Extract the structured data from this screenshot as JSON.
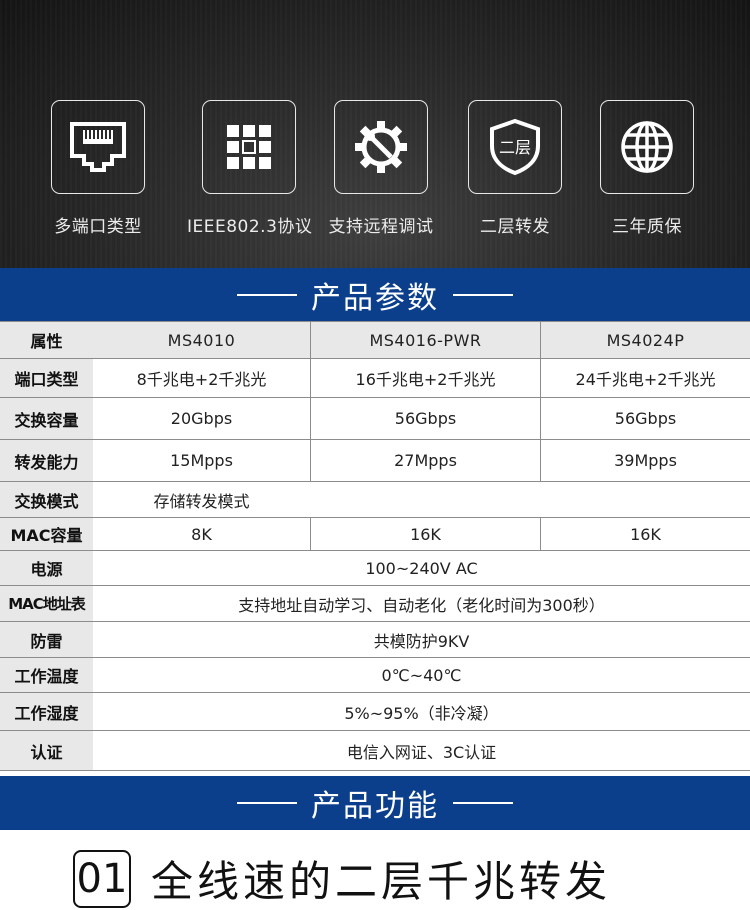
{
  "features": [
    {
      "icon": "ethernet-port-icon",
      "label": "多端口类型"
    },
    {
      "icon": "chip-grid-icon",
      "label": "IEEE802.3协议"
    },
    {
      "icon": "wrench-gear-icon",
      "label": "支持远程调试"
    },
    {
      "icon": "shield-icon",
      "label": "二层转发",
      "icon_text": "二层"
    },
    {
      "icon": "globe-icon",
      "label": "三年质保"
    }
  ],
  "params_section": {
    "title": "产品参数"
  },
  "specs_table": {
    "header_label": "属性",
    "models": [
      "MS4010",
      "MS4016-PWR",
      "MS4024P"
    ],
    "rows": [
      {
        "label": "端口类型",
        "values": [
          "8千兆电+2千兆光",
          "16千兆电+2千兆光",
          "24千兆电+2千兆光"
        ]
      },
      {
        "label": "交换容量",
        "values": [
          "20Gbps",
          "56Gbps",
          "56Gbps"
        ]
      },
      {
        "label": "转发能力",
        "values": [
          "15Mpps",
          "27Mpps",
          "39Mpps"
        ]
      },
      {
        "label": "交换模式",
        "value": "存储转发模式"
      },
      {
        "label": "MAC容量",
        "values": [
          "8K",
          "16K",
          "16K"
        ]
      },
      {
        "label": "电源",
        "value": "100~240V AC"
      },
      {
        "label": "MAC地址表",
        "value": "支持地址自动学习、自动老化（老化时间为300秒）"
      },
      {
        "label": "防雷",
        "value": "共模防护9KV"
      },
      {
        "label": "工作温度",
        "value": "0℃~40℃"
      },
      {
        "label": "工作湿度",
        "value": "5%~95%（非冷凝）"
      },
      {
        "label": "认证",
        "value": "电信入网证、3C认证"
      }
    ]
  },
  "function_section": {
    "title": "产品功能"
  },
  "headline": {
    "number": "01",
    "text": "全线速的二层千兆转发"
  },
  "colors": {
    "band": "#0b3f8c",
    "hero_dark": "#1a1a1a",
    "label_bg": "#e8e8e8"
  }
}
